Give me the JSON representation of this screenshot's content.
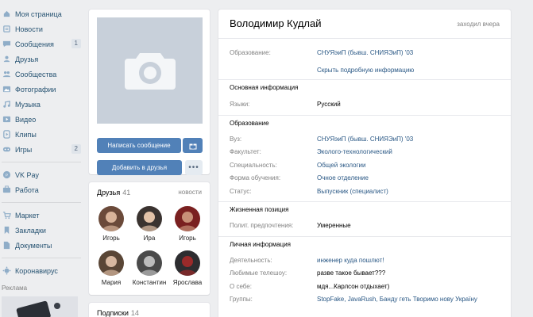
{
  "sidebar": {
    "items": [
      {
        "label": "Моя страница",
        "icon": "home-icon"
      },
      {
        "label": "Новости",
        "icon": "news-icon"
      },
      {
        "label": "Сообщения",
        "icon": "messages-icon",
        "badge": "1"
      },
      {
        "label": "Друзья",
        "icon": "friends-icon"
      },
      {
        "label": "Сообщества",
        "icon": "communities-icon"
      },
      {
        "label": "Фотографии",
        "icon": "photos-icon"
      },
      {
        "label": "Музыка",
        "icon": "music-icon"
      },
      {
        "label": "Видео",
        "icon": "video-icon"
      },
      {
        "label": "Клипы",
        "icon": "clips-icon"
      },
      {
        "label": "Игры",
        "icon": "games-icon",
        "badge": "2"
      }
    ],
    "items2": [
      {
        "label": "VK Pay",
        "icon": "vkpay-icon"
      },
      {
        "label": "Работа",
        "icon": "work-icon"
      }
    ],
    "items3": [
      {
        "label": "Маркет",
        "icon": "market-icon"
      },
      {
        "label": "Закладки",
        "icon": "bookmarks-icon"
      },
      {
        "label": "Документы",
        "icon": "documents-icon"
      }
    ],
    "items4": [
      {
        "label": "Коронавирус",
        "icon": "coronavirus-icon"
      }
    ],
    "ads_title": "Реклама"
  },
  "profile": {
    "buttons": {
      "message": "Написать сообщение",
      "add_friend": "Добавить в друзья",
      "more": "•••"
    }
  },
  "friends": {
    "title": "Друзья",
    "count": "41",
    "link": "новости",
    "list": [
      "Игорь",
      "Ира",
      "Игорь",
      "Мария",
      "Константин",
      "Ярослава"
    ]
  },
  "subscriptions": {
    "title": "Подписки",
    "count": "14"
  },
  "info": {
    "name": "Володимир Кудлай",
    "last_seen": "заходил вчера",
    "education_label": "Образование:",
    "education_value": "СНУЯэиП (бывш. СНИЯЭиП) '03",
    "show_more": "Скрыть подробную информацию",
    "sections": {
      "basic": "Основная информация",
      "education": "Образование",
      "position": "Жизненная позиция",
      "personal": "Личная информация"
    },
    "basic_rows": [
      {
        "k": "Языки:",
        "v": "Русский"
      }
    ],
    "edu_rows": [
      {
        "k": "Вуз:",
        "v": "СНУЯэиП (бывш. СНИЯЭиП) '03"
      },
      {
        "k": "Факультет:",
        "v": "Эколого-технологический"
      },
      {
        "k": "Специальность:",
        "v": "Общей экологии"
      },
      {
        "k": "Форма обучения:",
        "v": "Очное отделение"
      },
      {
        "k": "Статус:",
        "v": "Выпускник (специалист)"
      }
    ],
    "position_rows": [
      {
        "k": "Полит. предпочтения:",
        "v": "Умеренные"
      }
    ],
    "personal_rows": [
      {
        "k": "Деятельность:",
        "v": "инженер куда пошлют!"
      },
      {
        "k": "Любимые телешоу:",
        "v": "разве такое бывает???"
      },
      {
        "k": "О себе:",
        "v": "мдя...Карлсон отдыхает)"
      },
      {
        "k": "Группы:",
        "v": "StopFake, JavaRush, Банду геть Творимо нову Україну"
      }
    ]
  },
  "colors": {
    "accent": "#5181b8",
    "link": "#2a5885",
    "background": "#edeef0",
    "muted": "#828282"
  }
}
